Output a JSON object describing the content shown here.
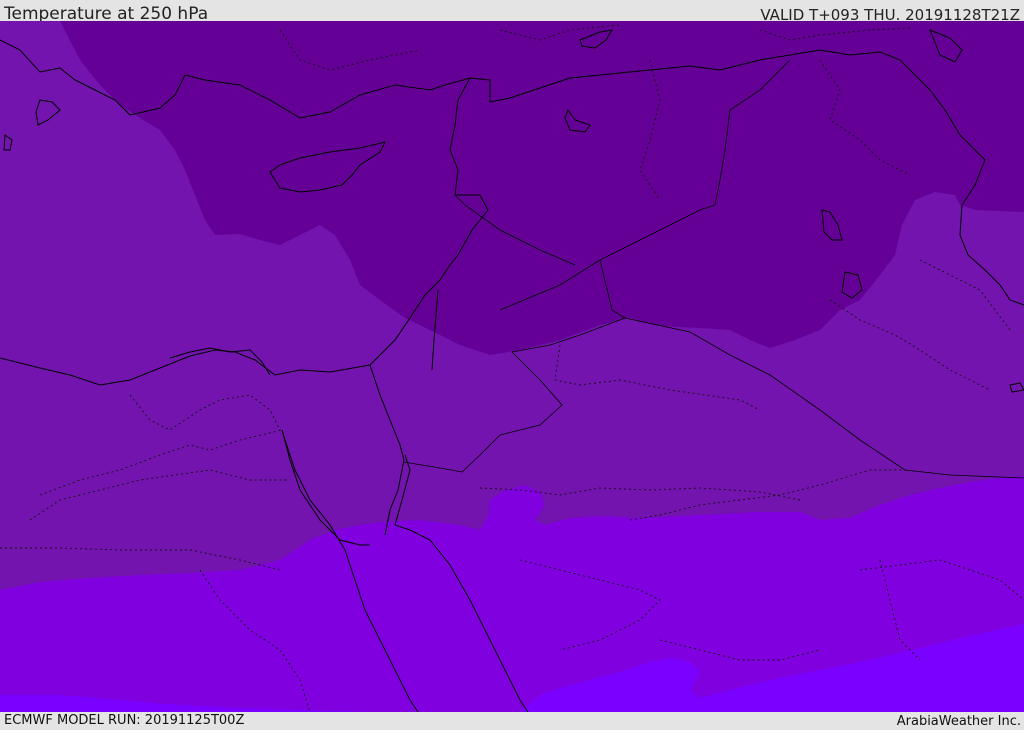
{
  "header": {
    "title": "Temperature at 250 hPa",
    "valid": "VALID T+093 THU. 20191128T21Z"
  },
  "footer": {
    "model_run": "ECMWF MODEL RUN: 20191125T00Z",
    "credit": "ArabiaWeather Inc."
  },
  "map": {
    "region": "Eastern Mediterranean / Middle East",
    "temperature_bands": [
      {
        "level": "coldest",
        "color": "#640096"
      },
      {
        "level": "cold",
        "color": "#7212ab"
      },
      {
        "level": "mid",
        "color": "#7000b4"
      },
      {
        "level": "warm",
        "color": "#8000e0"
      },
      {
        "level": "warmest",
        "color": "#7a00ff"
      }
    ],
    "coastline_color": "#000000",
    "border_style": "dotted"
  }
}
